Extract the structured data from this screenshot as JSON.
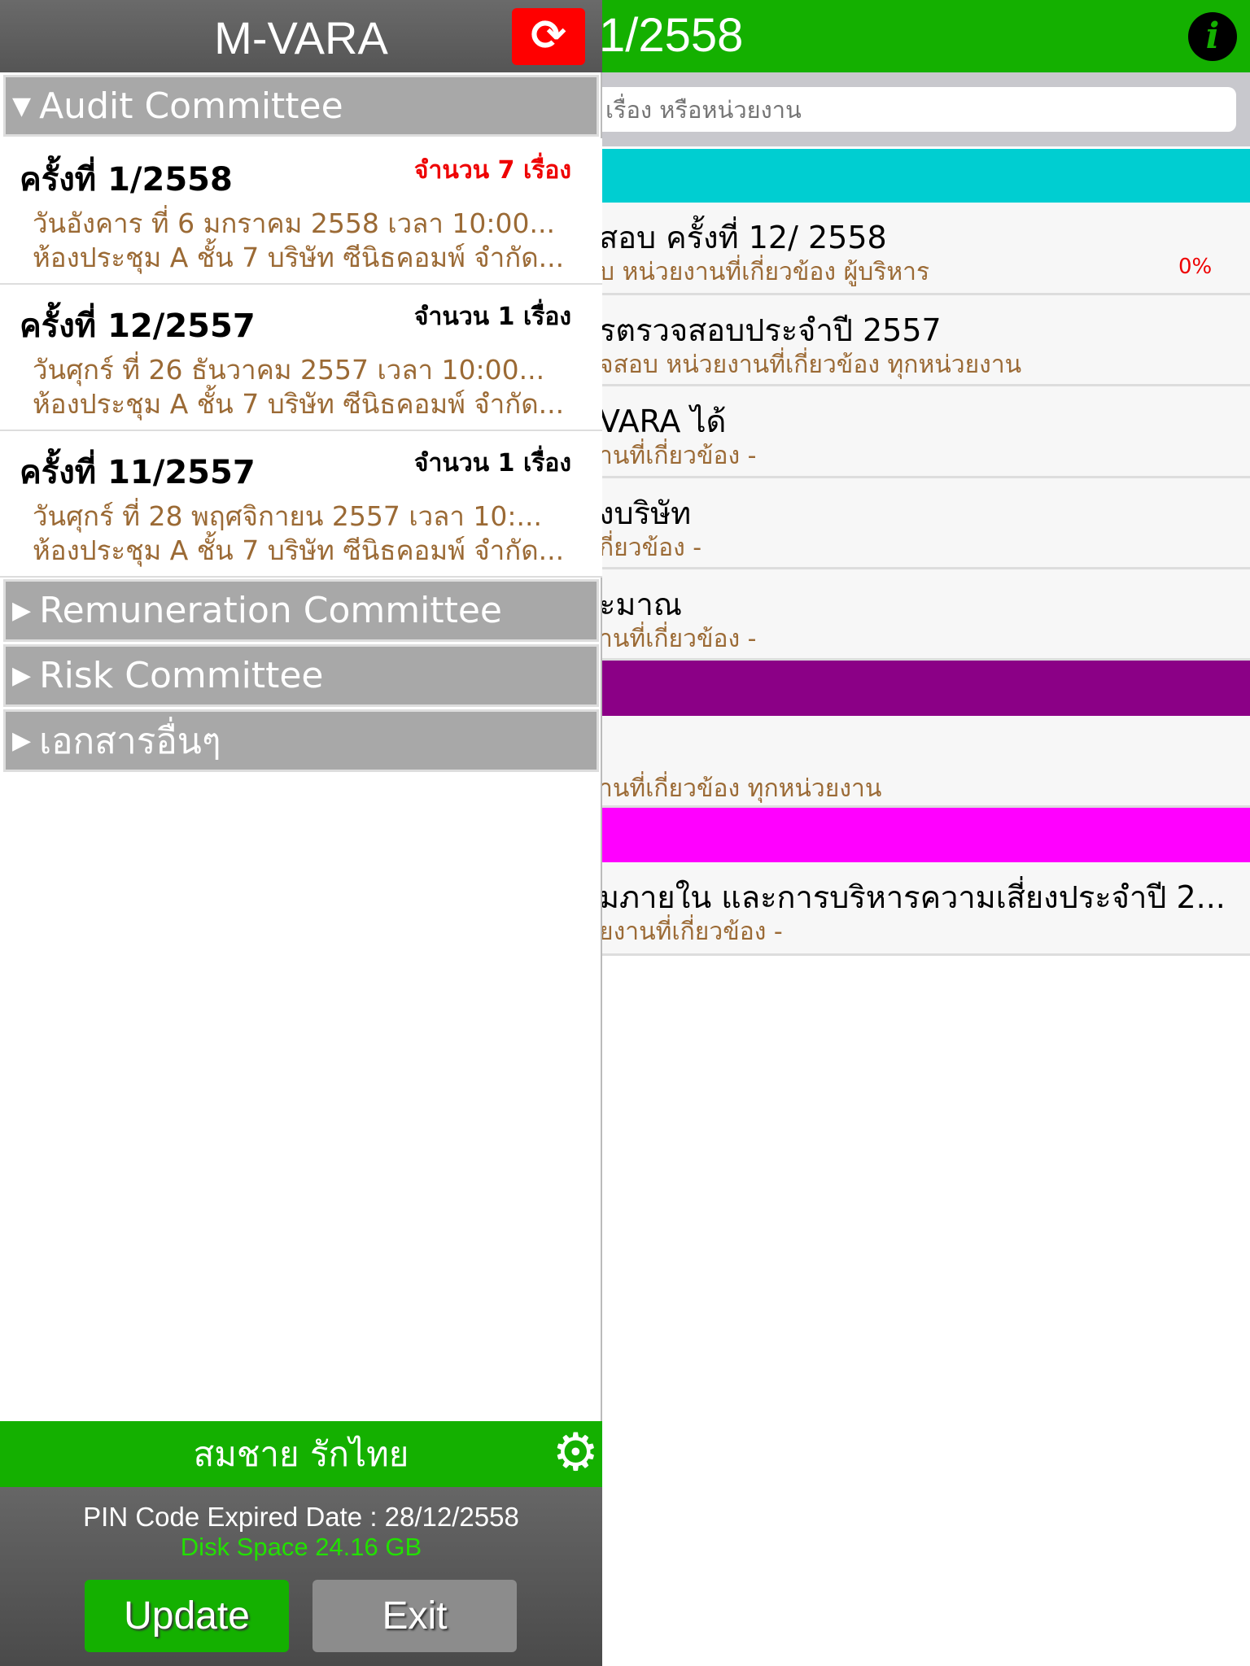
{
  "left": {
    "title": "M-VARA",
    "refresh_icon": "refresh-icon",
    "sections": [
      {
        "label": "Audit Committee",
        "expanded": true
      },
      {
        "label": "Remuneration Committee",
        "expanded": false
      },
      {
        "label": "Risk Committee",
        "expanded": false
      },
      {
        "label": "เอกสารอื่นๆ",
        "expanded": false
      }
    ],
    "meetings": [
      {
        "name": "ครั้งที่ 1/2558",
        "count": "จำนวน 7 เรื่อง",
        "date": "วันอังคาร ที่ 6 มกราคม 2558 เวลา 10:00...",
        "place": "ห้องประชุม A ชั้น 7 บริษัท ซีนิธคอมพ์ จำกัด...",
        "highlight": true
      },
      {
        "name": "ครั้งที่ 12/2557",
        "count": "จำนวน 1 เรื่อง",
        "date": "วันศุกร์ ที่ 26 ธันวาคม 2557 เวลา 10:00...",
        "place": "ห้องประชุม A ชั้น 7 บริษัท ซีนิธคอมพ์ จำกัด...",
        "highlight": false
      },
      {
        "name": "ครั้งที่ 11/2557",
        "count": "จำนวน 1 เรื่อง",
        "date": "วันศุกร์ ที่ 28 พฤศจิกายน 2557 เวลา 10:...",
        "place": "ห้องประชุม A ชั้น 7 บริษัท ซีนิธคอมพ์ จำกัด...",
        "highlight": false
      }
    ],
    "user_name": "สมชาย รักไทย",
    "pin_expired": "PIN Code Expired Date : 28/12/2558",
    "disk_space": "Disk Space 24.16 GB",
    "update_label": "Update",
    "exit_label": "Exit"
  },
  "right": {
    "title": "1/2558",
    "search_placeholder": "เรื่อง หรือหน่วยงาน",
    "colors": {
      "header": "#14b000",
      "cyan": "#00ced1",
      "purple": "#8b0086",
      "magenta": "#ff00ff"
    },
    "rows": [
      {
        "title": "สอบ ครั้งที่ 12/ 2558",
        "sub": "บ  หน่วยงานที่เกี่ยวข้อง ผู้บริหาร",
        "progress": "0%"
      },
      {
        "title": "รตรวจสอบประจำปี 2557",
        "sub": "จสอบ  หน่วยงานที่เกี่ยวข้อง ทุกหน่วยงาน"
      },
      {
        "title": "VARA ได้",
        "sub": "านที่เกี่ยวข้อง -"
      },
      {
        "title": "งบริษัท",
        "sub": "กี่ยวข้อง -"
      },
      {
        "title": "ะมาณ",
        "sub": "านที่เกี่ยวข้อง -"
      },
      {
        "title": "",
        "sub": "านที่เกี่ยวข้อง ทุกหน่วยงาน"
      },
      {
        "title": "ุมภายใน และการบริหารความเสี่ยงประจำปี 2...",
        "sub": "ยงานที่เกี่ยวข้อง -"
      }
    ]
  }
}
